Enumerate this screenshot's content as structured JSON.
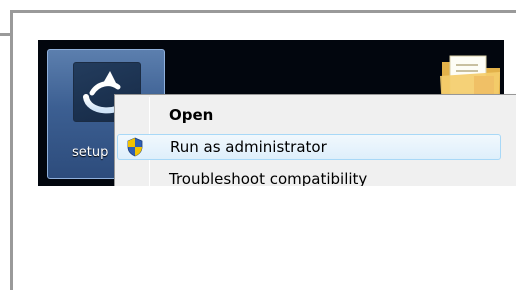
{
  "desktop": {
    "icons": [
      {
        "label": "setup",
        "icon": "setup-installer-icon",
        "selected": true
      },
      {
        "label": "",
        "icon": "folder-icon",
        "selected": false
      }
    ]
  },
  "context_menu": {
    "items": [
      {
        "label": "Open",
        "bold": true,
        "icon": ""
      },
      {
        "label": "Run as administrator",
        "bold": false,
        "icon": "uac-shield-icon",
        "highlighted": true
      },
      {
        "label": "Troubleshoot compatibility",
        "bold": false,
        "icon": ""
      }
    ]
  },
  "colors": {
    "desktop_bg": "#02060e",
    "selection_blue": "#3c5f92",
    "menu_bg": "#f0f0f0",
    "hover_border": "#a8d8f7",
    "frame_grey": "#9a9a9a"
  }
}
